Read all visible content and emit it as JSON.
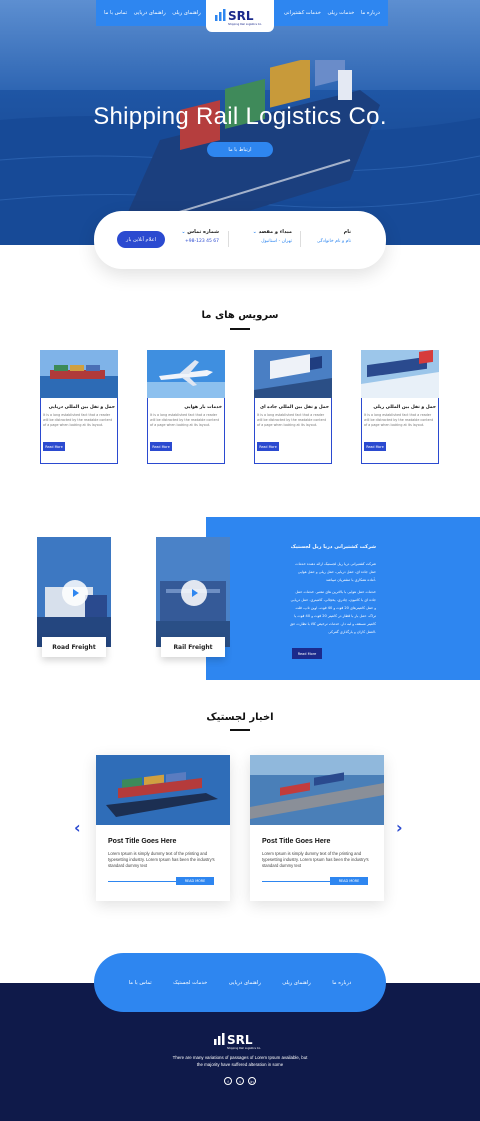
{
  "nav": {
    "items_right": [
      "درباره ما",
      "خدمات ریلی",
      "خدمات کشتیرانی"
    ],
    "items_left": [
      "راهنمای ریلی",
      "راهنمای دریایی",
      "تماس با ما"
    ]
  },
  "brand": {
    "logo_text": "SRL",
    "logo_subtitle": "Shipping Rail Logistics Co."
  },
  "hero": {
    "title": "Shipping Rail Logistics Co.",
    "cta": "ارتباط با ما"
  },
  "booking": {
    "name_label": "نام",
    "name_value": "نام و نام خانوادگی",
    "route_label": "مبداء و مقصد",
    "route_value": "تهران - استانبول",
    "phone_label": "شماره تماس",
    "phone_value": "+98-123 45 67",
    "submit": "اعلام آنلاین بار"
  },
  "services": {
    "title": "سرویس های ما",
    "cards": [
      {
        "title": "حمل و نقل بین المللی دریایی",
        "text": "It is a long established fact that a reader will be distracted by the readable content of a page when looking at its layout.",
        "button": "Read More"
      },
      {
        "title": "خدمات بار هوایی",
        "text": "It is a long established fact that a reader will be distracted by the readable content of a page when looking at its layout.",
        "button": "Read More"
      },
      {
        "title": "حمل و نقل بین المللی جاده ای",
        "text": "It is a long established fact that a reader will be distracted by the readable content of a page when looking at its layout.",
        "button": "Read More"
      },
      {
        "title": "حمل و نقل بین المللی ریلی",
        "text": "It is a long established fact that a reader will be distracted by the readable content of a page when looking at its layout.",
        "button": "Read More"
      }
    ]
  },
  "about": {
    "title": "شرکت کشتیرانی دریا ریل لجستیک",
    "paragraph1": "شرکت کشتیرانی دریا ریل لجستیک ارائه دهنده خدمات حمل جاده ای، حمل دریایی، حمل ریلی و حمل هوایی آماده همکاری با مشتریان میباشد.",
    "paragraph2": "خدمات حمل هوایی با بالاترین های معتبر. خدمات حمل جاده ای با کامیون، چادری، یخچالی، کانتینری. حمل دریایی و حمل کانتینرهای 20 فوت و 40 فوت، اوپن تاپ، فلت تراک، حمل بار با قطار در کانتینر 20 فوت و 40 فوت یا کانتینر مسقف و لبه دار. خدمات ترخیص کالا با نظارت حق العمل کاران و بارگذاری گمرکی.",
    "button": "Read More",
    "freight": [
      "Road Freight",
      "Rail Freight"
    ]
  },
  "news": {
    "title": "اخبار لجستیک",
    "cards": [
      {
        "title": "Post Title Goes Here",
        "text": "Lorem Ipsum is simply dummy text of the printing and typesetting industry. Lorem Ipsum has been the industry's standard dummy text",
        "button": "READ MORE"
      },
      {
        "title": "Post Title Goes Here",
        "text": "Lorem Ipsum is simply dummy text of the printing and typesetting industry. Lorem Ipsum has been the industry's standard dummy text",
        "button": "READ MORE"
      }
    ]
  },
  "footer": {
    "nav": [
      "تماس با ما",
      "خدمات لجستیک",
      "راهنمای دریایی",
      "راهنمای ریلی",
      "درباره ما"
    ],
    "text": "There are many variations of passages of Lorem Ipsum available, but the majority have suffered alteration in some",
    "socials": [
      "f",
      "t",
      "in"
    ]
  },
  "colors": {
    "primary": "#2e86f0",
    "dark_blue": "#2b4ad0",
    "navy": "#0f1a4a"
  }
}
